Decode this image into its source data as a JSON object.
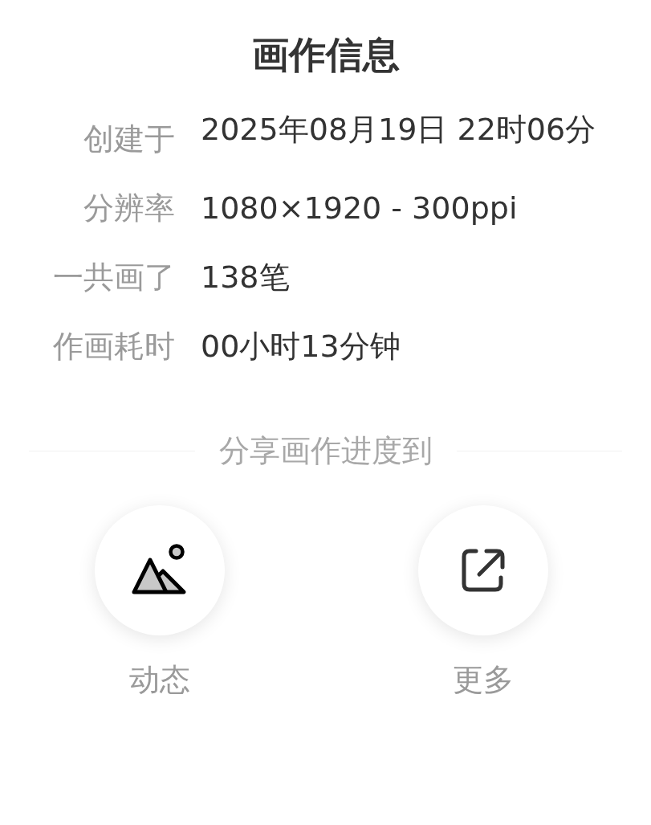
{
  "title": "画作信息",
  "info": [
    {
      "label": "创建于",
      "value": "2025年08月19日 22时06分"
    },
    {
      "label": "分辨率",
      "value": "1080×1920 - 300ppi"
    },
    {
      "label": "一共画了",
      "value": "138笔"
    },
    {
      "label": "作画耗时",
      "value": "00小时13分钟"
    }
  ],
  "share": {
    "heading": "分享画作进度到",
    "targets": [
      {
        "kind": "moment",
        "label": "动态"
      },
      {
        "kind": "more",
        "label": "更多"
      }
    ]
  }
}
